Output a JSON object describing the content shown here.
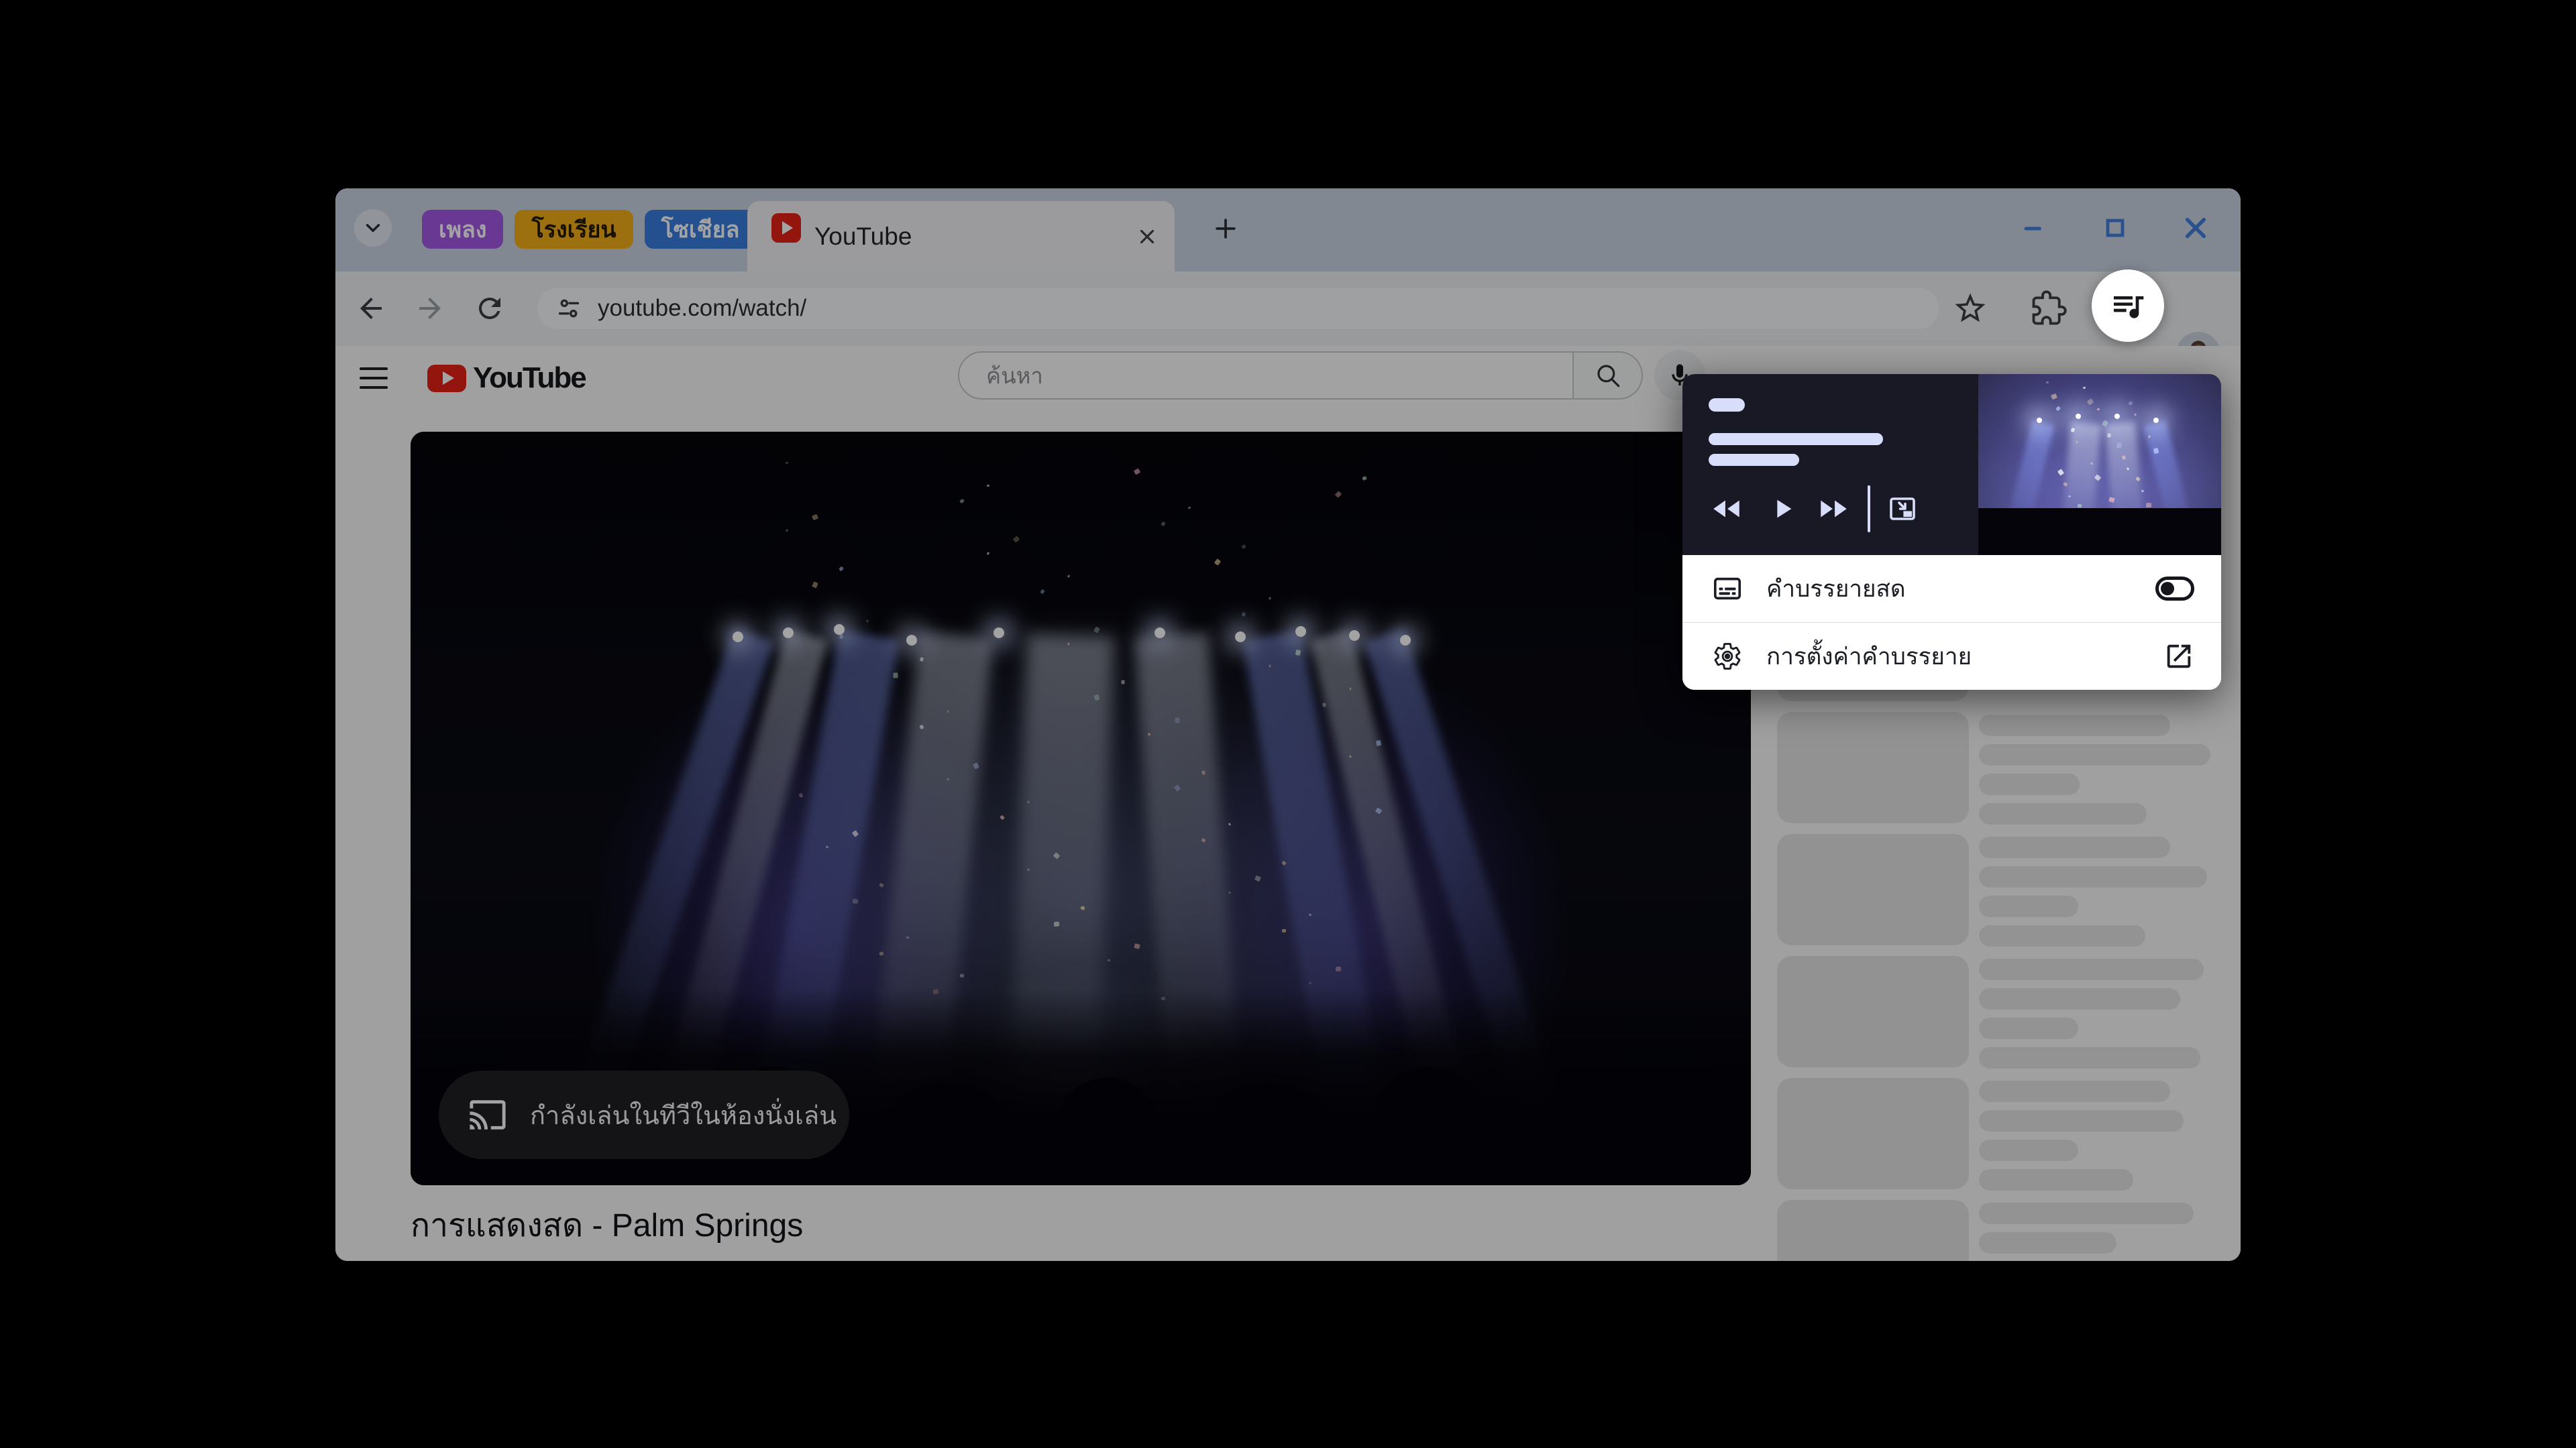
{
  "tab_strip": {
    "tab_search_tooltip": "tab-search",
    "groups": [
      {
        "label": "เพลง",
        "color": "#a458e6",
        "text_color": "#ffffff"
      },
      {
        "label": "โรงเรียน",
        "color": "#f5b018",
        "text_color": "#231a00"
      },
      {
        "label": "โซเชียล",
        "color": "#3b7de0",
        "text_color": "#ffffff"
      }
    ],
    "active_tab": {
      "title": "YouTube"
    }
  },
  "window_controls": {
    "minimize": "minimize",
    "maximize": "maximize",
    "close": "close"
  },
  "toolbar": {
    "url": "youtube.com/watch/"
  },
  "youtube": {
    "search_placeholder": "ค้นหา",
    "video_title": "การแสดงสด - Palm Springs",
    "cast_overlay_text": "กำลังเล่นในทีวีในห้องนั่งเล่น",
    "sidebar_skeleton": [
      {
        "lines": []
      },
      {
        "lines": [
          285,
          345,
          150,
          250
        ]
      },
      {
        "lines": [
          285,
          340,
          148,
          248
        ]
      },
      {
        "lines": [
          335,
          300,
          148,
          330
        ]
      },
      {
        "lines": [
          285,
          305,
          148,
          230
        ]
      },
      {
        "lines": [
          320,
          205
        ]
      }
    ]
  },
  "media_popup": {
    "rows": [
      {
        "label": "คำบรรยายสด",
        "control": "toggle",
        "enabled": false
      },
      {
        "label": "การตั้งค่าคำบรรยาย",
        "control": "open-in-new"
      }
    ]
  },
  "icons": {
    "tab-search": "chevron-down",
    "new-tab": "plus",
    "back": "arrow-left",
    "forward": "arrow-right",
    "reload": "circular-arrow",
    "site-settings": "tune-sliders",
    "bookmark": "star-outline",
    "extensions": "puzzle-piece",
    "media-controls": "queue-music-note",
    "search": "magnifier",
    "voice-search": "microphone",
    "cast": "cast-screen-waves",
    "live-caption": "caption-box",
    "caption-settings": "gear",
    "open-in-new": "box-arrow",
    "pip": "picture-in-picture",
    "rewind": "double-triangle-left",
    "play": "triangle-right",
    "fast-forward": "double-triangle-right"
  },
  "colors": {
    "frame": "#ccd5e3",
    "window_control_blue": "#3f7fdd",
    "youtube_red": "#e62117",
    "popup_bg": "#181924",
    "popup_pill": "#d8ddfa",
    "scrim": "rgba(0,0,0,0.36)",
    "skeleton": "#e5e5e5"
  }
}
